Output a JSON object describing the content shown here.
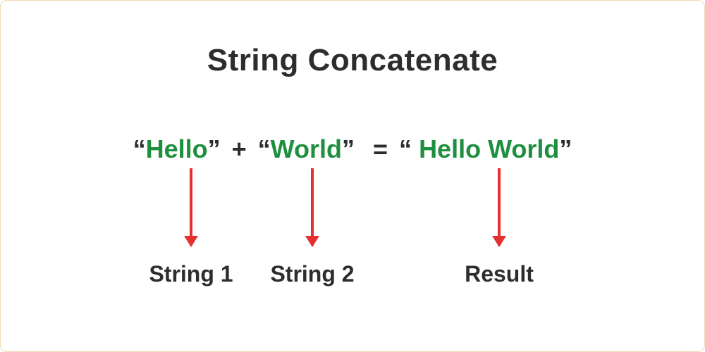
{
  "title": "String Concatenate",
  "expression": {
    "open_quote": "“",
    "close_quote": "”",
    "string1": "Hello",
    "plus": "+",
    "string2": "World",
    "equals": "=",
    "result_leading_space": " ",
    "result": "Hello World"
  },
  "labels": {
    "string1": "String 1",
    "string2": "String 2",
    "result": "Result"
  },
  "colors": {
    "text": "#2d2d2d",
    "string": "#1e8f3e",
    "arrow": "#e53030"
  }
}
